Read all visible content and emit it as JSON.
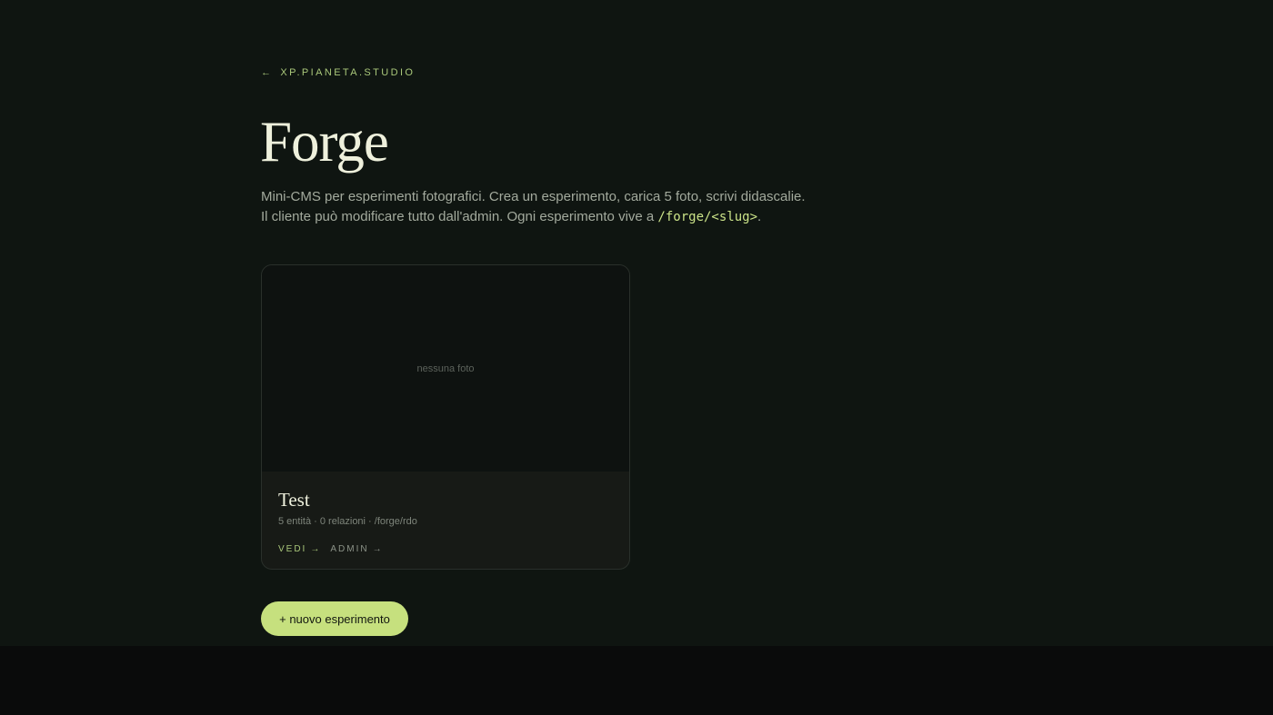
{
  "nav": {
    "back_arrow": "←",
    "back_label": "XP.PIANETA.STUDIO"
  },
  "header": {
    "title": "Forge",
    "intro_text": "Mini-CMS per esperimenti fotografici. Crea un esperimento, carica 5 foto, scrivi didascalie. Il cliente può modificare tutto dall'admin. Ogni esperimento vive a ",
    "intro_code": "/forge/<slug>",
    "intro_end": "."
  },
  "experiments": [
    {
      "photo_placeholder": "nessuna foto",
      "title": "Test",
      "meta": "5 entità · 0 relazioni · /forge/rdo",
      "view_label": "VEDI",
      "admin_label": "ADMIN",
      "link_arrow": "→"
    }
  ],
  "actions": {
    "new_experiment_label": "+ nuovo esperimento"
  },
  "colors": {
    "background": "#0f1511",
    "accent": "#c6e07e",
    "title": "#eef0dc"
  }
}
